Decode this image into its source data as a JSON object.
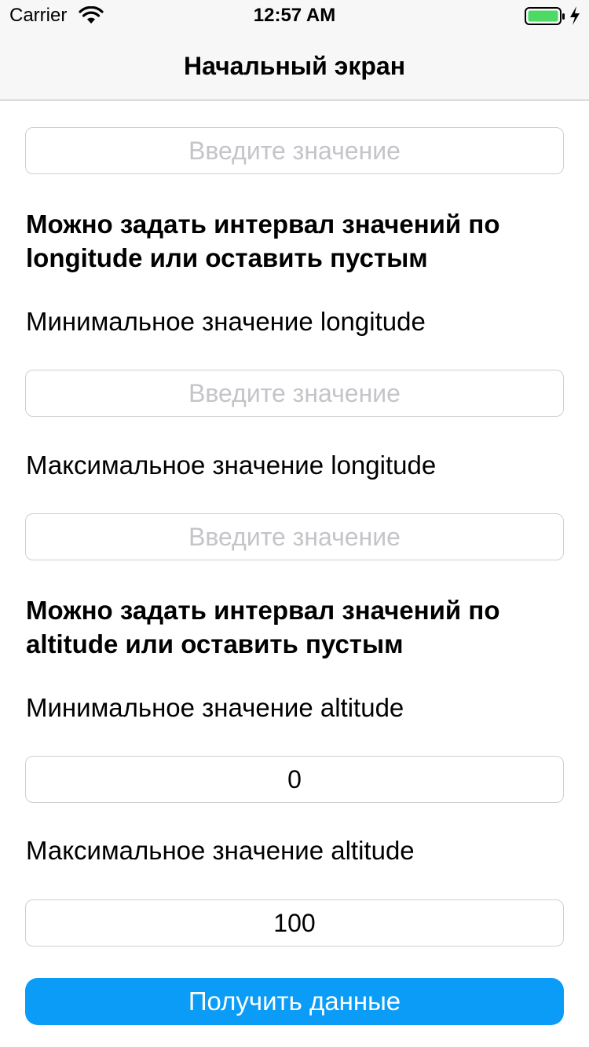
{
  "status_bar": {
    "carrier": "Carrier",
    "time": "12:57 AM",
    "wifi_icon": "wifi-icon",
    "battery_icon": "battery-icon",
    "charging_icon": "charging-bolt-icon",
    "battery_color": "#4cd964"
  },
  "nav": {
    "title": "Начальный экран"
  },
  "form": {
    "top_field": {
      "value": "",
      "placeholder": "Введите значение"
    },
    "longitude_section": {
      "title": "Можно задать интервал значений по longitude или оставить пустым",
      "min_label": "Минимальное значение longitude",
      "min_field": {
        "value": "",
        "placeholder": "Введите значение"
      },
      "max_label": "Максимальное значение longitude",
      "max_field": {
        "value": "",
        "placeholder": "Введите значение"
      }
    },
    "altitude_section": {
      "title": "Можно задать интервал значений по altitude или оставить пустым",
      "min_label": "Минимальное значение altitude",
      "min_field": {
        "value": "0",
        "placeholder": "Введите значение"
      },
      "max_label": "Максимальное значение altitude",
      "max_field": {
        "value": "100",
        "placeholder": "Введите значение"
      }
    },
    "submit_label": "Получить данные"
  },
  "colors": {
    "accent": "#0a9cf7",
    "placeholder": "#c4c4c9",
    "field_border": "#cfcfcf",
    "bar_background": "#f7f7f7"
  }
}
